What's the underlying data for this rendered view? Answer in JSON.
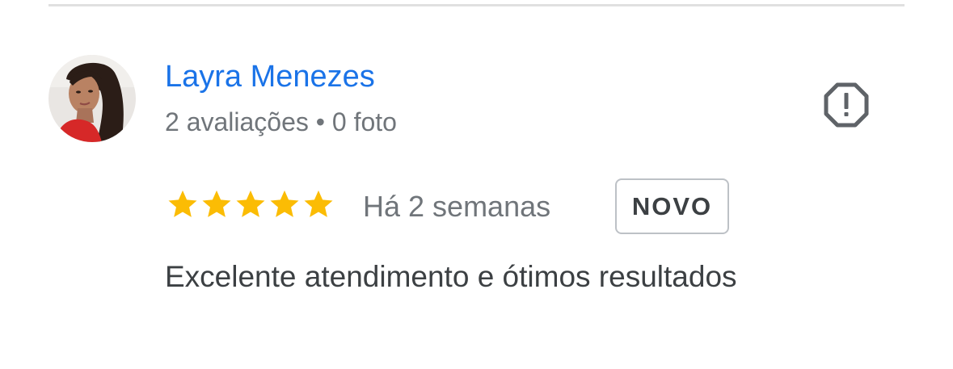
{
  "review": {
    "author": {
      "name": "Layra Menezes",
      "meta": "2 avaliações • 0 foto",
      "avatar": "avatar-photo"
    },
    "report_icon": "report-octagon-icon",
    "rating": {
      "stars": 5,
      "max": 5,
      "star_color": "#fbbc04"
    },
    "time": "Há 2 semanas",
    "badge": "NOVO",
    "text": "Excelente atendimento e ótimos resultados"
  },
  "colors": {
    "name_link": "#1a73e8",
    "secondary_text": "#70757a",
    "body_text": "#3c4043",
    "divider": "#e0e0e0"
  }
}
